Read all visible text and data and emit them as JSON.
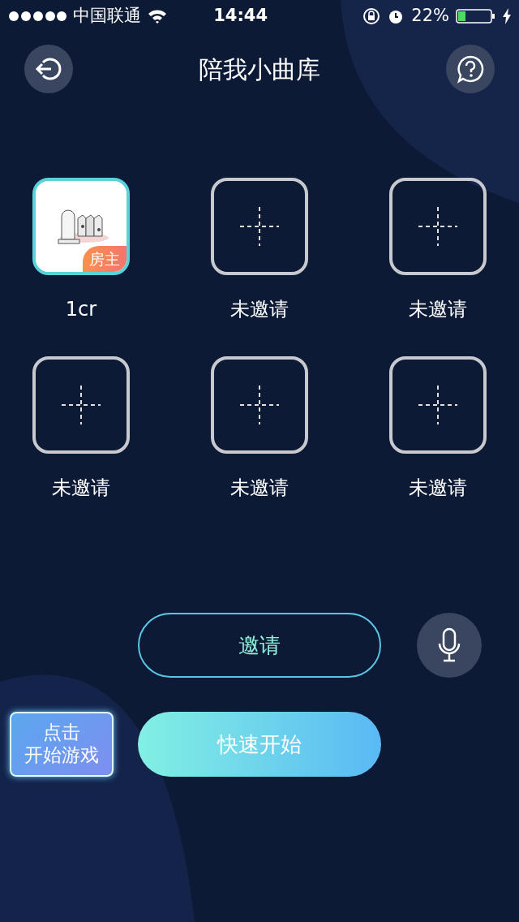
{
  "status_bar": {
    "carrier": "中国联通",
    "time": "14:44",
    "battery": "22%"
  },
  "header": {
    "title": "陪我小曲库"
  },
  "slots": [
    {
      "kind": "host",
      "name": "1cr",
      "badge": "房主"
    },
    {
      "kind": "empty",
      "name": "未邀请"
    },
    {
      "kind": "empty",
      "name": "未邀请"
    },
    {
      "kind": "empty",
      "name": "未邀请"
    },
    {
      "kind": "empty",
      "name": "未邀请"
    },
    {
      "kind": "empty",
      "name": "未邀请"
    }
  ],
  "invite_button": "邀请",
  "start_button": "快速开始",
  "hint": [
    "点击",
    "开始游戏"
  ]
}
